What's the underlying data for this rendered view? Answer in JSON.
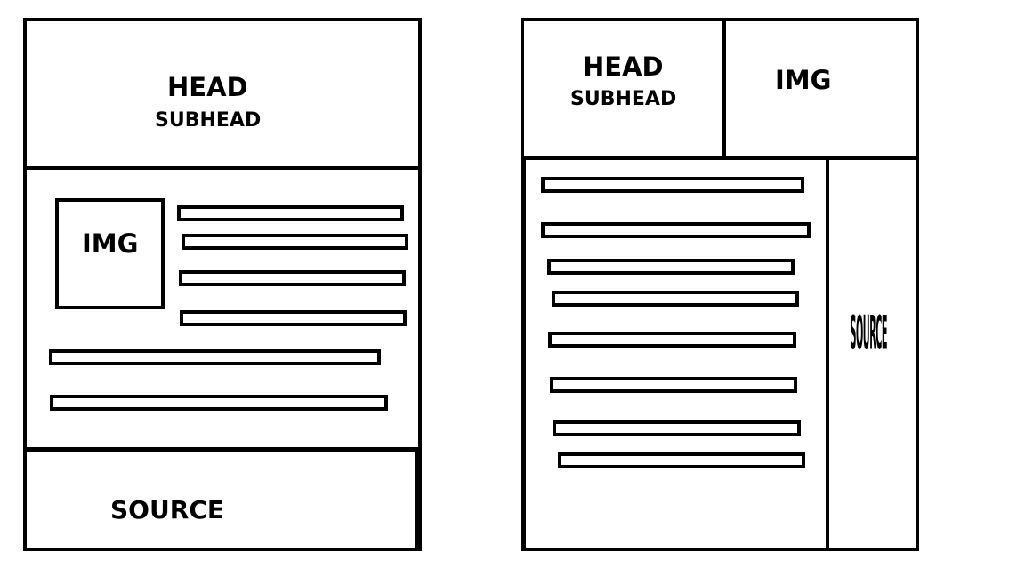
{
  "layouts": [
    {
      "head": "HEAD",
      "subhead": "SUBHEAD",
      "img": "IMG",
      "source": "SOURCE"
    },
    {
      "head": "HEAD",
      "subhead": "SUBHEAD",
      "img": "IMG",
      "source": "SOURCE"
    }
  ]
}
